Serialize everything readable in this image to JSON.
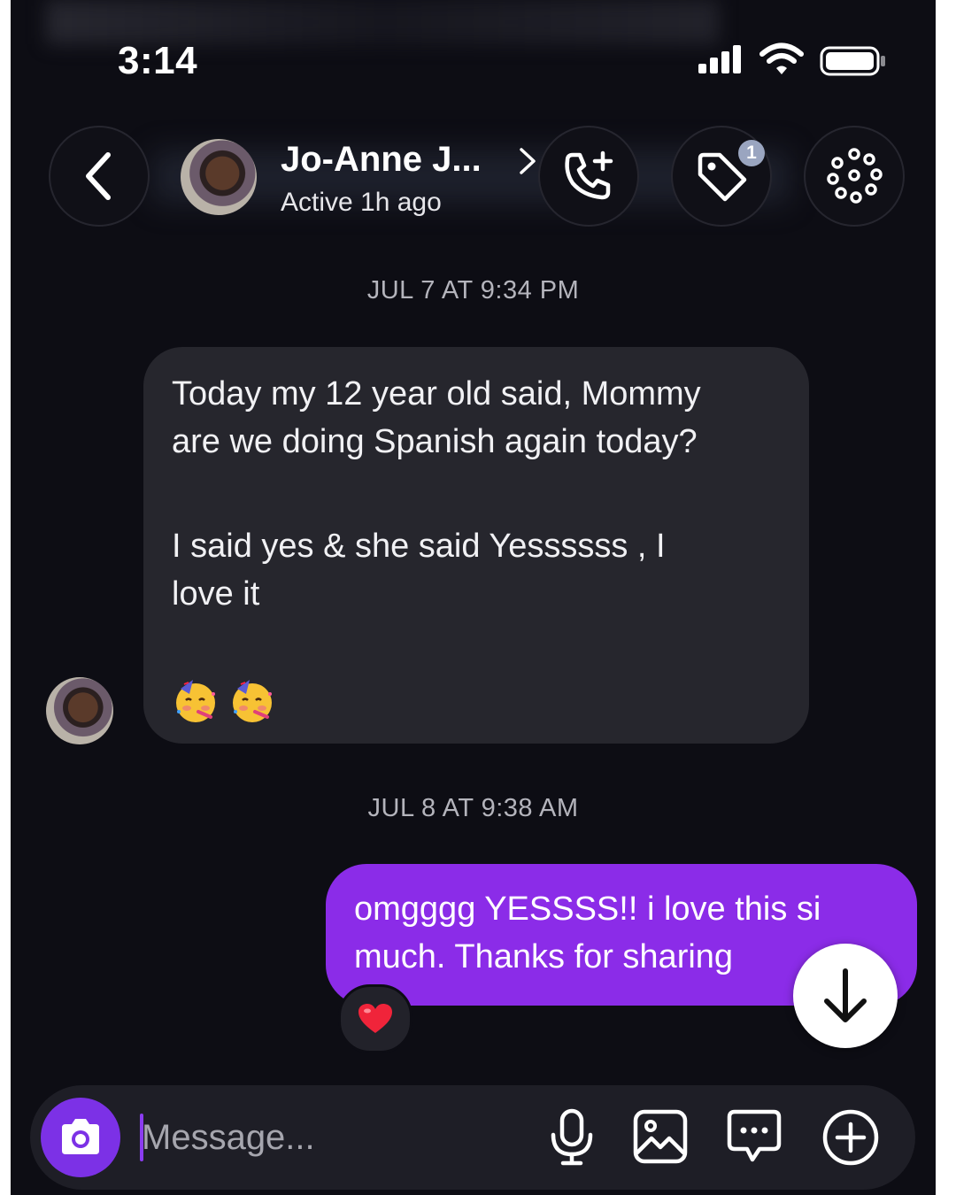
{
  "status_bar": {
    "time": "3:14",
    "icons": [
      "signal-icon",
      "wifi-icon",
      "battery-icon"
    ]
  },
  "header": {
    "contact_name": "Jo-Anne J...",
    "contact_status": "Active 1h ago",
    "buttons": [
      "back-button",
      "call-add-button",
      "tag-button",
      "effects-button"
    ],
    "tag_badge_count": "1"
  },
  "messages": [
    {
      "timestamp": "JUL 7 AT 9:34 PM",
      "direction": "incoming",
      "lines": [
        "Today my 12 year old said, Mommy",
        "are we doing Spanish again today?",
        "I said yes & she said Yessssss , I",
        "love it"
      ],
      "emojis": [
        "🥳",
        "🥳"
      ]
    },
    {
      "timestamp": "JUL 8 AT 9:38 AM",
      "direction": "outgoing",
      "lines": [
        "omgggg YESSSS!! i love this si",
        "much. Thanks for sharing"
      ],
      "reaction": "❤️"
    }
  ],
  "composer": {
    "placeholder": "Message...",
    "icons": [
      "camera-icon",
      "mic-icon",
      "gallery-icon",
      "sticker-icon",
      "add-icon"
    ]
  },
  "colors": {
    "background": "#0d0d14",
    "incoming_bubble": "#26262d",
    "outgoing_bubble": "#8b2ce8",
    "accent": "#7c31e6"
  }
}
